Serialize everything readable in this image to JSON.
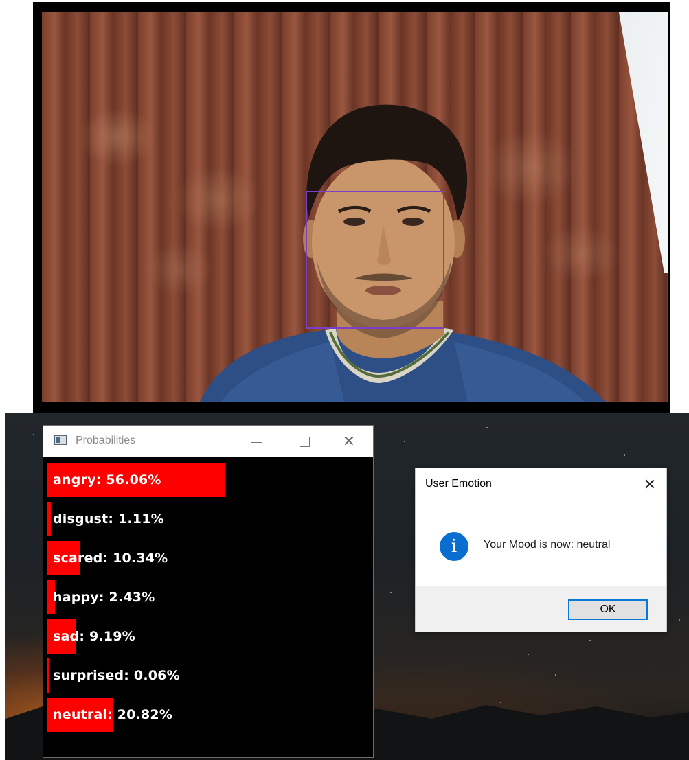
{
  "probabilities_window": {
    "title": "Probabilities",
    "bars": [
      {
        "label": "angry: 56.06%",
        "value": 0.5606
      },
      {
        "label": "disgust: 1.11%",
        "value": 0.0111
      },
      {
        "label": "scared: 10.34%",
        "value": 0.1034
      },
      {
        "label": "happy: 2.43%",
        "value": 0.0243
      },
      {
        "label": "sad: 9.19%",
        "value": 0.0919
      },
      {
        "label": "surprised: 0.06%",
        "value": 0.0006
      },
      {
        "label": "neutral: 20.82%",
        "value": 0.2082
      }
    ],
    "bar_color": "#ff0000"
  },
  "message_box": {
    "title": "User Emotion",
    "message": "Your Mood is now: neutral",
    "icon": "info-icon",
    "ok_label": "OK"
  },
  "webcam": {
    "face_box_color": "#7b3fc8"
  }
}
